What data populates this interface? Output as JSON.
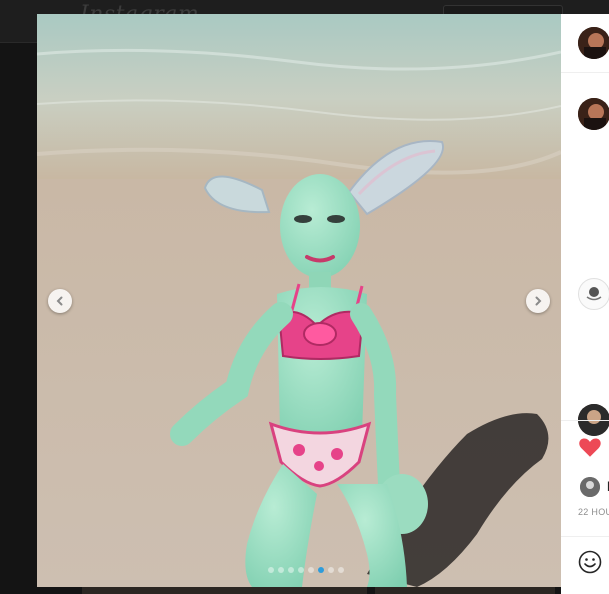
{
  "page": {
    "brand_logo": "Instagram"
  },
  "photo": {
    "alt_subject": "ball-jointed doll on beach",
    "carousel": {
      "total": 8,
      "current": 6
    }
  },
  "navigation": {
    "prev_icon": "chevron-left-icon",
    "next_icon": "chevron-right-icon"
  },
  "panel": {
    "like_icon": "heart-icon",
    "like_color": "#ed4956",
    "liked_by_initial": "l",
    "timestamp": "22 HOU",
    "emoji_icon": "smiley-icon"
  },
  "colors": {
    "accent_dot": "#2d9cdb",
    "panel_bg": "#ffffff",
    "overlay_bg": "#141414"
  }
}
